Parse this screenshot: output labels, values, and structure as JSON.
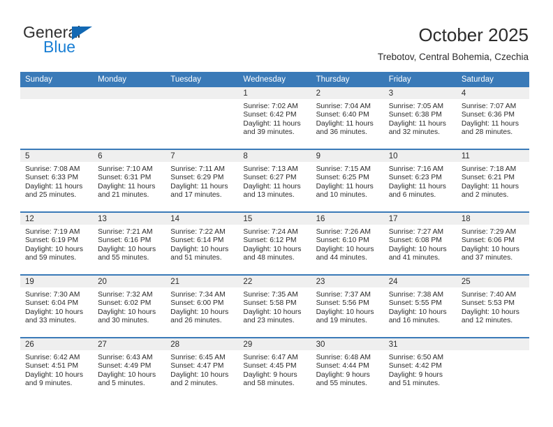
{
  "logo": {
    "word_top": "General",
    "word_bottom": "Blue",
    "triangle_icon": "triangle-icon",
    "accent_color": "#1268b3",
    "blue_text_color": "#1a7fd4"
  },
  "header": {
    "title": "October 2025",
    "subtitle": "Trebotov, Central Bohemia, Czechia"
  },
  "theme": {
    "header_blue": "#3a7ab8",
    "daynum_band": "#efefef",
    "cell_background": "#ffffff",
    "text": "#2b2b2b"
  },
  "labels": {
    "sunrise": "Sunrise:",
    "sunset": "Sunset:",
    "daylight": "Daylight:"
  },
  "weekdays": [
    "Sunday",
    "Monday",
    "Tuesday",
    "Wednesday",
    "Thursday",
    "Friday",
    "Saturday"
  ],
  "weeks": [
    [
      {
        "day": "",
        "sunrise": "",
        "sunset": "",
        "daylight": "",
        "empty": true
      },
      {
        "day": "",
        "sunrise": "",
        "sunset": "",
        "daylight": "",
        "empty": true
      },
      {
        "day": "",
        "sunrise": "",
        "sunset": "",
        "daylight": "",
        "empty": true
      },
      {
        "day": "1",
        "sunrise": "Sunrise: 7:02 AM",
        "sunset": "Sunset: 6:42 PM",
        "daylight": "Daylight: 11 hours and 39 minutes."
      },
      {
        "day": "2",
        "sunrise": "Sunrise: 7:04 AM",
        "sunset": "Sunset: 6:40 PM",
        "daylight": "Daylight: 11 hours and 36 minutes."
      },
      {
        "day": "3",
        "sunrise": "Sunrise: 7:05 AM",
        "sunset": "Sunset: 6:38 PM",
        "daylight": "Daylight: 11 hours and 32 minutes."
      },
      {
        "day": "4",
        "sunrise": "Sunrise: 7:07 AM",
        "sunset": "Sunset: 6:36 PM",
        "daylight": "Daylight: 11 hours and 28 minutes."
      }
    ],
    [
      {
        "day": "5",
        "sunrise": "Sunrise: 7:08 AM",
        "sunset": "Sunset: 6:33 PM",
        "daylight": "Daylight: 11 hours and 25 minutes."
      },
      {
        "day": "6",
        "sunrise": "Sunrise: 7:10 AM",
        "sunset": "Sunset: 6:31 PM",
        "daylight": "Daylight: 11 hours and 21 minutes."
      },
      {
        "day": "7",
        "sunrise": "Sunrise: 7:11 AM",
        "sunset": "Sunset: 6:29 PM",
        "daylight": "Daylight: 11 hours and 17 minutes."
      },
      {
        "day": "8",
        "sunrise": "Sunrise: 7:13 AM",
        "sunset": "Sunset: 6:27 PM",
        "daylight": "Daylight: 11 hours and 13 minutes."
      },
      {
        "day": "9",
        "sunrise": "Sunrise: 7:15 AM",
        "sunset": "Sunset: 6:25 PM",
        "daylight": "Daylight: 11 hours and 10 minutes."
      },
      {
        "day": "10",
        "sunrise": "Sunrise: 7:16 AM",
        "sunset": "Sunset: 6:23 PM",
        "daylight": "Daylight: 11 hours and 6 minutes."
      },
      {
        "day": "11",
        "sunrise": "Sunrise: 7:18 AM",
        "sunset": "Sunset: 6:21 PM",
        "daylight": "Daylight: 11 hours and 2 minutes."
      }
    ],
    [
      {
        "day": "12",
        "sunrise": "Sunrise: 7:19 AM",
        "sunset": "Sunset: 6:19 PM",
        "daylight": "Daylight: 10 hours and 59 minutes."
      },
      {
        "day": "13",
        "sunrise": "Sunrise: 7:21 AM",
        "sunset": "Sunset: 6:16 PM",
        "daylight": "Daylight: 10 hours and 55 minutes."
      },
      {
        "day": "14",
        "sunrise": "Sunrise: 7:22 AM",
        "sunset": "Sunset: 6:14 PM",
        "daylight": "Daylight: 10 hours and 51 minutes."
      },
      {
        "day": "15",
        "sunrise": "Sunrise: 7:24 AM",
        "sunset": "Sunset: 6:12 PM",
        "daylight": "Daylight: 10 hours and 48 minutes."
      },
      {
        "day": "16",
        "sunrise": "Sunrise: 7:26 AM",
        "sunset": "Sunset: 6:10 PM",
        "daylight": "Daylight: 10 hours and 44 minutes."
      },
      {
        "day": "17",
        "sunrise": "Sunrise: 7:27 AM",
        "sunset": "Sunset: 6:08 PM",
        "daylight": "Daylight: 10 hours and 41 minutes."
      },
      {
        "day": "18",
        "sunrise": "Sunrise: 7:29 AM",
        "sunset": "Sunset: 6:06 PM",
        "daylight": "Daylight: 10 hours and 37 minutes."
      }
    ],
    [
      {
        "day": "19",
        "sunrise": "Sunrise: 7:30 AM",
        "sunset": "Sunset: 6:04 PM",
        "daylight": "Daylight: 10 hours and 33 minutes."
      },
      {
        "day": "20",
        "sunrise": "Sunrise: 7:32 AM",
        "sunset": "Sunset: 6:02 PM",
        "daylight": "Daylight: 10 hours and 30 minutes."
      },
      {
        "day": "21",
        "sunrise": "Sunrise: 7:34 AM",
        "sunset": "Sunset: 6:00 PM",
        "daylight": "Daylight: 10 hours and 26 minutes."
      },
      {
        "day": "22",
        "sunrise": "Sunrise: 7:35 AM",
        "sunset": "Sunset: 5:58 PM",
        "daylight": "Daylight: 10 hours and 23 minutes."
      },
      {
        "day": "23",
        "sunrise": "Sunrise: 7:37 AM",
        "sunset": "Sunset: 5:56 PM",
        "daylight": "Daylight: 10 hours and 19 minutes."
      },
      {
        "day": "24",
        "sunrise": "Sunrise: 7:38 AM",
        "sunset": "Sunset: 5:55 PM",
        "daylight": "Daylight: 10 hours and 16 minutes."
      },
      {
        "day": "25",
        "sunrise": "Sunrise: 7:40 AM",
        "sunset": "Sunset: 5:53 PM",
        "daylight": "Daylight: 10 hours and 12 minutes."
      }
    ],
    [
      {
        "day": "26",
        "sunrise": "Sunrise: 6:42 AM",
        "sunset": "Sunset: 4:51 PM",
        "daylight": "Daylight: 10 hours and 9 minutes."
      },
      {
        "day": "27",
        "sunrise": "Sunrise: 6:43 AM",
        "sunset": "Sunset: 4:49 PM",
        "daylight": "Daylight: 10 hours and 5 minutes."
      },
      {
        "day": "28",
        "sunrise": "Sunrise: 6:45 AM",
        "sunset": "Sunset: 4:47 PM",
        "daylight": "Daylight: 10 hours and 2 minutes."
      },
      {
        "day": "29",
        "sunrise": "Sunrise: 6:47 AM",
        "sunset": "Sunset: 4:45 PM",
        "daylight": "Daylight: 9 hours and 58 minutes."
      },
      {
        "day": "30",
        "sunrise": "Sunrise: 6:48 AM",
        "sunset": "Sunset: 4:44 PM",
        "daylight": "Daylight: 9 hours and 55 minutes."
      },
      {
        "day": "31",
        "sunrise": "Sunrise: 6:50 AM",
        "sunset": "Sunset: 4:42 PM",
        "daylight": "Daylight: 9 hours and 51 minutes."
      },
      {
        "day": "",
        "sunrise": "",
        "sunset": "",
        "daylight": "",
        "empty": true
      }
    ]
  ]
}
